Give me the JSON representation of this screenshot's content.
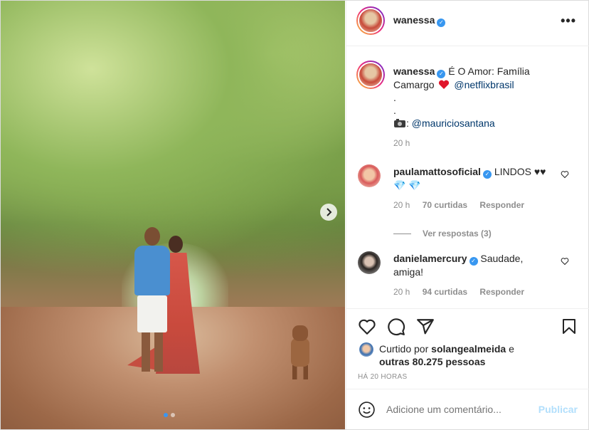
{
  "post": {
    "author": "wanessa",
    "caption_line1": "É O Amor: Família",
    "caption_line2": "Camargo",
    "caption_mention": "@netflixbrasil",
    "dot1": ".",
    "dot2": ".",
    "photo_credit_prefix": ":",
    "photo_credit_mention": "@mauriciosantana",
    "caption_time": "20 h",
    "carousel": {
      "slides": 2,
      "active": 1
    }
  },
  "comments": [
    {
      "user": "paulamattosoficial",
      "text": "LINDOS ♥♥",
      "emoji": "💎 💎",
      "time": "20 h",
      "likes": "70 curtidas",
      "reply": "Responder",
      "view_replies": "Ver respostas (3)"
    },
    {
      "user": "danielamercury",
      "text": "Saudade,",
      "text2": "amiga!",
      "time": "20 h",
      "likes": "94 curtidas",
      "reply": "Responder"
    }
  ],
  "likes": {
    "prefix": "Curtido por",
    "user": "solangealmeida",
    "mid": "e",
    "others": "outras 80.275 pessoas"
  },
  "timestamp": "HÁ 20 HORAS",
  "add_comment": {
    "placeholder": "Adicione um comentário...",
    "publish": "Publicar"
  },
  "colors": {
    "verified": "#3897f0",
    "publish_disabled": "#b2dffc",
    "link": "#00376b"
  },
  "icons": [
    "more-options-icon",
    "heart-icon",
    "comment-icon",
    "share-icon",
    "bookmark-icon",
    "emoji-icon",
    "chevron-right-icon",
    "camera-icon"
  ]
}
